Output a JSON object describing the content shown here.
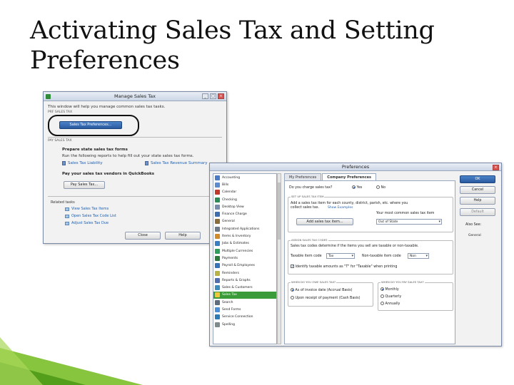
{
  "slide": {
    "title": "Activating Sales Tax and Setting Preferences"
  },
  "manage_sales_tax": {
    "title": "Manage Sales Tax",
    "intro": "This window will help you manage common sales tax tasks.",
    "section_sales_tax": "PRF SALES TAX",
    "preferences_button": "Sales Tax Preferences...",
    "section_pay": "PAY SALES TAX",
    "prepare_title": "Prepare state sales tax forms",
    "prepare_text": "Run the following reports to help fill out your state sales tax forms.",
    "reports": [
      "Sales Tax Liability",
      "Sales Tax Revenue Summary"
    ],
    "pay_title": "Pay your sales tax vendors in QuickBooks",
    "pay_button": "Pay Sales Tax...",
    "related_label": "Related tasks",
    "related": [
      "View Sales Tax Items",
      "Open Sales Tax Code List",
      "Adjust Sales Tax Due"
    ],
    "close_button": "Close",
    "help_button": "Help"
  },
  "preferences": {
    "title": "Preferences",
    "tabs": [
      "My Preferences",
      "Company Preferences"
    ],
    "categories": [
      {
        "label": "Accounting",
        "color": "#4a7bc4"
      },
      {
        "label": "Bills",
        "color": "#5b8ccf"
      },
      {
        "label": "Calendar",
        "color": "#c0392b"
      },
      {
        "label": "Checking",
        "color": "#2e8b57"
      },
      {
        "label": "Desktop View",
        "color": "#7a8cab"
      },
      {
        "label": "Finance Charge",
        "color": "#3d6fb0"
      },
      {
        "label": "General",
        "color": "#8a6d3b"
      },
      {
        "label": "Integrated Applications",
        "color": "#6c7a89"
      },
      {
        "label": "Items & Inventory",
        "color": "#d08b2c"
      },
      {
        "label": "Jobs & Estimates",
        "color": "#3a7fc1"
      },
      {
        "label": "Multiple Currencies",
        "color": "#2f9e5a"
      },
      {
        "label": "Payments",
        "color": "#2b7a3b"
      },
      {
        "label": "Payroll & Employees",
        "color": "#3773b8"
      },
      {
        "label": "Reminders",
        "color": "#b9b244"
      },
      {
        "label": "Reports & Graphs",
        "color": "#4f6fae"
      },
      {
        "label": "Sales & Customers",
        "color": "#3c8dbc"
      },
      {
        "label": "Sales Tax",
        "color": "#f3c53b"
      },
      {
        "label": "Search",
        "color": "#5d6d7e"
      },
      {
        "label": "Send Forms",
        "color": "#4a90d9"
      },
      {
        "label": "Service Connection",
        "color": "#2c7bb6"
      },
      {
        "label": "Spelling",
        "color": "#7f8c8d"
      }
    ],
    "selected_category": "Sales Tax",
    "charge_question": "Do you charge sales tax?",
    "yes_label": "Yes",
    "no_label": "No",
    "group_setup": "SET UP SALES TAX ITEM",
    "setup_text_1": "Add a sales tax item for each county, district, parish, etc. where you",
    "setup_text_2": "collect sales tax.",
    "show_examples": "Show Examples",
    "add_item_button": "Add sales tax item...",
    "most_common_label": "Your most common sales tax item",
    "most_common_value": "Out of State",
    "group_codes": "ASSIGN SALES TAX CODES",
    "codes_text": "Sales tax codes determine if the items you sell are taxable or non-taxable.",
    "taxable_label": "Taxable item code",
    "taxable_value": "Tax",
    "nontaxable_label": "Non-taxable item code",
    "nontaxable_value": "Non",
    "identify_label": "Identify taxable amounts as \"T\" for \"Taxable\" when printing",
    "group_owe": "WHEN DO YOU OWE SALES TAX?",
    "owe_options": [
      "As of invoice date (Accrual Basis)",
      "Upon receipt of payment (Cash Basis)"
    ],
    "group_pay": "WHEN DO YOU PAY SALES TAX?",
    "pay_options": [
      "Monthly",
      "Quarterly",
      "Annually"
    ],
    "buttons": {
      "ok": "OK",
      "cancel": "Cancel",
      "help": "Help",
      "default": "Default",
      "also_see": "Also See:",
      "general": "General"
    }
  }
}
